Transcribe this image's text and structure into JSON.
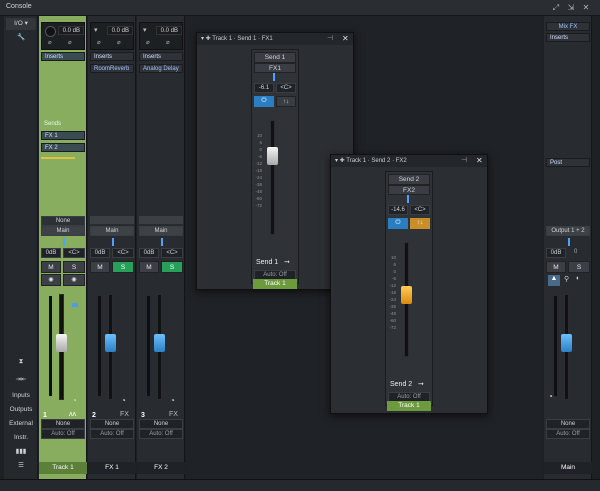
{
  "window": {
    "title": "Console"
  },
  "left_panel": {
    "io_label": "I/O",
    "io_dropdown": "▾",
    "nav": [
      "Inputs",
      "Outputs",
      "External",
      "Instr."
    ]
  },
  "channels": [
    {
      "id": "track1",
      "footer": "Track 1",
      "number": "1",
      "gain": "0.0 dB",
      "inserts_label": "Inserts",
      "insert": "",
      "sends_label": "Sends",
      "sends": [
        "FX 1",
        "FX 2"
      ],
      "input": "None",
      "output": "Main",
      "volume": "0dB",
      "pan": "<C>",
      "automation": "Auto: Off",
      "mute": "M",
      "solo": "S",
      "io_none": "None",
      "fader_level": 0.55,
      "scale": [
        "10",
        "6",
        "0",
        "-6",
        "-12",
        "-18",
        "-24",
        "-36",
        "-48",
        "-60",
        "-72"
      ]
    },
    {
      "id": "fx1",
      "footer": "FX 1",
      "number": "2",
      "gain": "0.0 dB",
      "inserts_label": "Inserts",
      "insert": "RoomReverb",
      "output": "Main",
      "volume": "0dB",
      "pan": "<C>",
      "automation": "Auto: Off",
      "mute": "M",
      "solo": "S",
      "io_none": "None",
      "type": "FX",
      "fader_level": 0.55
    },
    {
      "id": "fx2",
      "footer": "FX 2",
      "number": "3",
      "gain": "0.0 dB",
      "inserts_label": "Inserts",
      "insert": "Analog Delay",
      "output": "Main",
      "volume": "0dB",
      "pan": "<C>",
      "automation": "Auto: Off",
      "mute": "M",
      "solo": "S",
      "io_none": "None",
      "type": "FX",
      "fader_level": 0.55
    }
  ],
  "main_channel": {
    "footer": "Main",
    "mixfx_label": "Mix FX",
    "inserts_label": "Inserts",
    "post_label": "Post",
    "output": "Output 1 + 2",
    "volume": "0dB",
    "vol_zero": "0",
    "mute": "M",
    "solo": "S",
    "io_none": "None",
    "automation": "Auto: Off"
  },
  "send_windows": [
    {
      "title": "Track 1 · Send 1 · FX1",
      "send_label": "Send 1",
      "dest": "FX1",
      "value": "-6.1",
      "pan": "<C>",
      "power_icon": "power-icon",
      "tail": "Send 1",
      "automation": "Auto: Off",
      "track": "Track 1",
      "extra_btn": "↑↓",
      "level": 0.72,
      "accent": "#2a7fc2"
    },
    {
      "title": "Track 1 · Send 2 · FX2",
      "send_label": "Send 2",
      "dest": "FX2",
      "value": "-14.6",
      "pan": "<C>",
      "power_icon": "power-icon",
      "tail": "Send 2",
      "automation": "Auto: Off",
      "track": "Track 1",
      "extra_btn": "↑↓",
      "level": 0.55,
      "accent": "#c98e2a"
    }
  ],
  "scale": [
    "10",
    "6",
    "0",
    "-6",
    "-12",
    "-18",
    "-24",
    "-36",
    "-48",
    "-60",
    "-72"
  ]
}
